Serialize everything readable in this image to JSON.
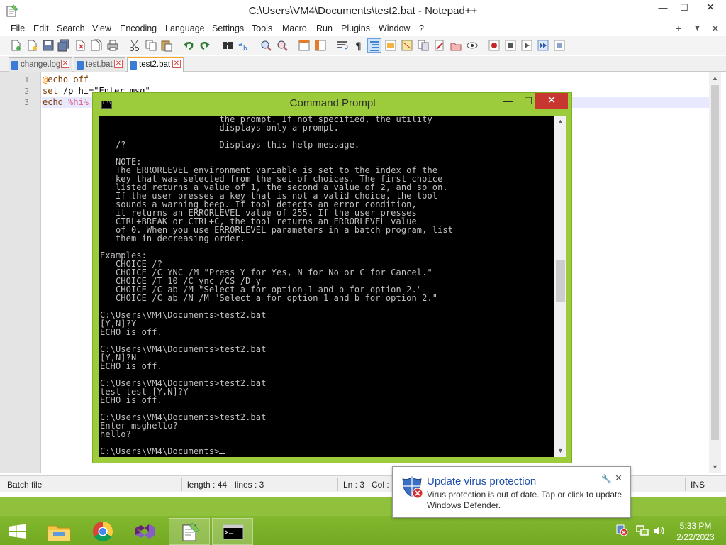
{
  "npp": {
    "title": "C:\\Users\\VM4\\Documents\\test2.bat - Notepad++",
    "window_controls": {
      "minimize": "—",
      "maximize": "☐",
      "close": "✕"
    },
    "menu": [
      "File",
      "Edit",
      "Search",
      "View",
      "Encoding",
      "Language",
      "Settings",
      "Tools",
      "Macro",
      "Run",
      "Plugins",
      "Window",
      "?"
    ],
    "menu_right": [
      "+",
      "▼",
      "✕"
    ],
    "tabs": [
      {
        "label": "change.log",
        "active": false
      },
      {
        "label": "test.bat",
        "active": false
      },
      {
        "label": "test2.bat",
        "active": true
      }
    ],
    "tab_close": "✕",
    "line_numbers": [
      "1",
      "2",
      "3"
    ],
    "code": {
      "line1_at": "@",
      "line1_rest": "echo off",
      "line2_kw": "set",
      "line2_rest": " /p hi=\"Enter msg\"",
      "line3_kw": "echo",
      "line3_var": " %hi%"
    },
    "status": {
      "filetype": "Batch file",
      "length": "length : 44",
      "lines": "lines : 3",
      "ln": "Ln : 3",
      "col": "Col :",
      "mode": "INS"
    }
  },
  "cmd": {
    "title": "Command Prompt",
    "window_controls": {
      "minimize": "—",
      "maximize": "☐",
      "close": "✕"
    },
    "lines": [
      "                       the prompt. If not specified, the utility",
      "                       displays only a prompt.",
      "",
      "   /?                  Displays this help message.",
      "",
      "   NOTE:",
      "   The ERRORLEVEL environment variable is set to the index of the",
      "   key that was selected from the set of choices. The first choice",
      "   listed returns a value of 1, the second a value of 2, and so on.",
      "   If the user presses a key that is not a valid choice, the tool",
      "   sounds a warning beep. If tool detects an error condition,",
      "   it returns an ERRORLEVEL value of 255. If the user presses",
      "   CTRL+BREAK or CTRL+C, the tool returns an ERRORLEVEL value",
      "   of 0. When you use ERRORLEVEL parameters in a batch program, list",
      "   them in decreasing order.",
      "",
      "Examples:",
      "   CHOICE /?",
      "   CHOICE /C YNC /M \"Press Y for Yes, N for No or C for Cancel.\"",
      "   CHOICE /T 10 /C ync /CS /D y",
      "   CHOICE /C ab /M \"Select a for option 1 and b for option 2.\"",
      "   CHOICE /C ab /N /M \"Select a for option 1 and b for option 2.\"",
      "",
      "C:\\Users\\VM4\\Documents>test2.bat",
      "[Y,N]?Y",
      "ECHO is off.",
      "",
      "C:\\Users\\VM4\\Documents>test2.bat",
      "[Y,N]?N",
      "ECHO is off.",
      "",
      "C:\\Users\\VM4\\Documents>test2.bat",
      "test test [Y,N]?Y",
      "ECHO is off.",
      "",
      "C:\\Users\\VM4\\Documents>test2.bat",
      "Enter msghello?",
      "hello?",
      ""
    ],
    "prompt": "C:\\Users\\VM4\\Documents>"
  },
  "toast": {
    "title": "Update virus protection",
    "body": "Virus protection is out of date. Tap or click to update Windows Defender.",
    "pin": "🔧",
    "close": "✕"
  },
  "taskbar": {
    "apps": [
      "start-button",
      "file-explorer",
      "chrome",
      "visual-studio",
      "notepad-plus-plus",
      "command-prompt"
    ],
    "clock_time": "5:33 PM",
    "clock_date": "2/22/2023"
  },
  "colors": {
    "cmd_frame": "#9ccc3c",
    "taskbar": "#8fc23b",
    "cmd_close": "#c7372f",
    "toast_title": "#1e4fa8"
  }
}
